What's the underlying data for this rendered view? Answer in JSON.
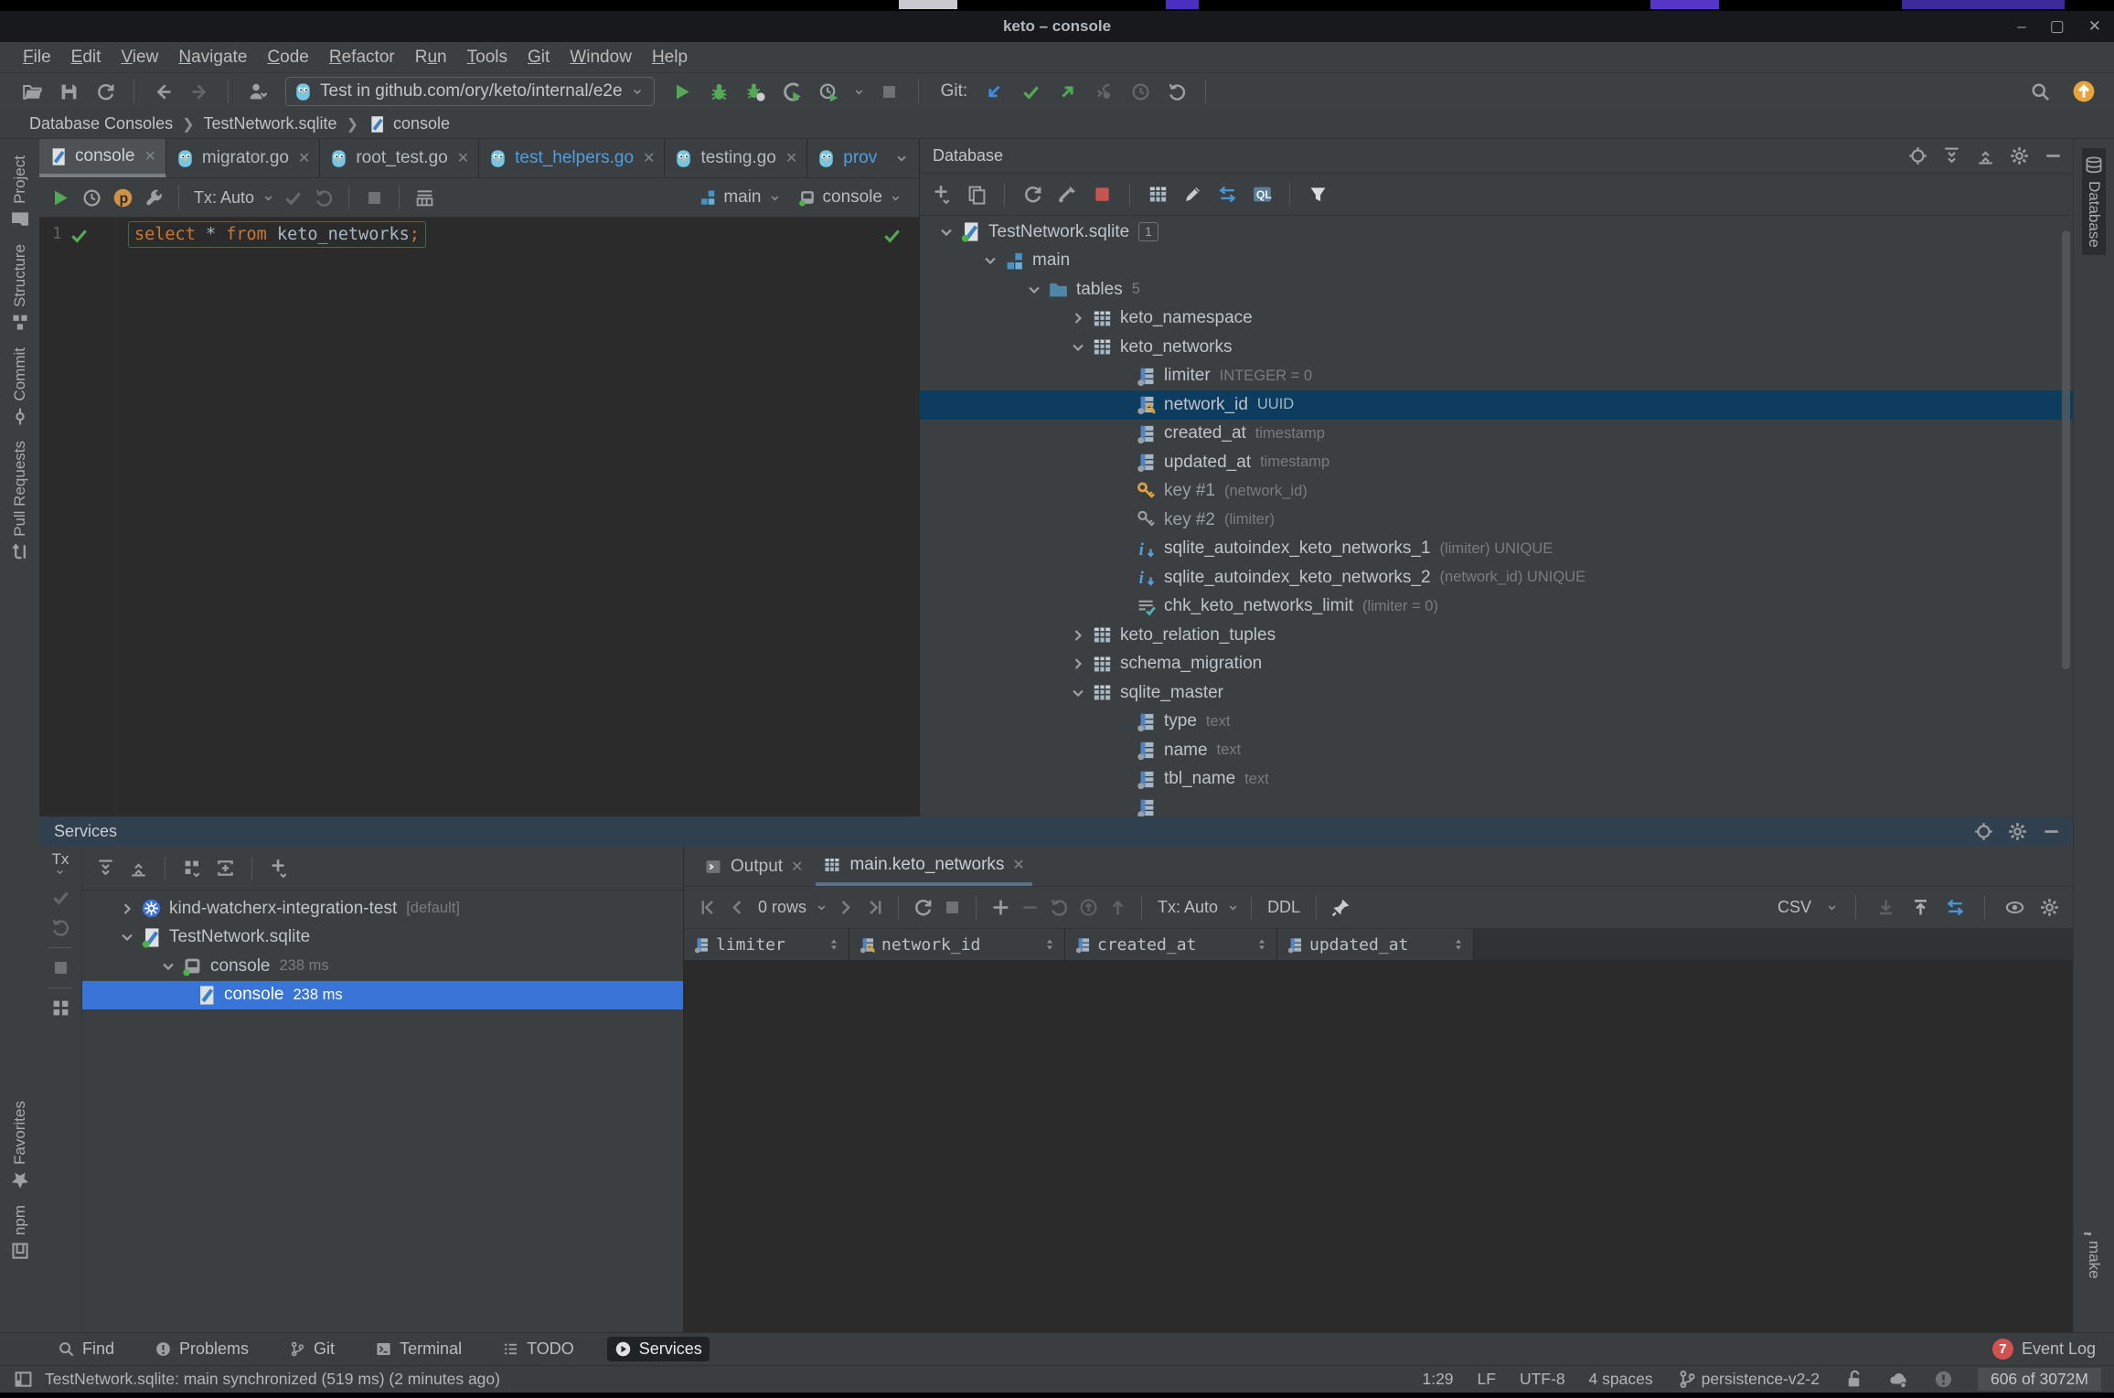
{
  "colors": {
    "panel_bg": "#3c3f41",
    "editor_bg": "#2b2b2b",
    "selection_blue": "#3875d6",
    "tree_selection": "#0d3c5e",
    "accent_green": "#54a857",
    "keyword_orange": "#cc7832",
    "key_gold": "#d9a343",
    "error_red": "#c75450",
    "event_badge_red": "#d25252",
    "services_header": "#31404f",
    "modified_tab_blue": "#4f9ee0"
  },
  "title_bar": {
    "title": "keto – console"
  },
  "menu_items": [
    {
      "label": "File",
      "u": 0
    },
    {
      "label": "Edit",
      "u": 0
    },
    {
      "label": "View",
      "u": 0
    },
    {
      "label": "Navigate",
      "u": 0
    },
    {
      "label": "Code",
      "u": 0
    },
    {
      "label": "Refactor",
      "u": 0
    },
    {
      "label": "Run",
      "u": 1
    },
    {
      "label": "Tools",
      "u": 0
    },
    {
      "label": "Git",
      "u": 0
    },
    {
      "label": "Window",
      "u": 0
    },
    {
      "label": "Help",
      "u": 0
    }
  ],
  "main_toolbar": {
    "run_config": "Test in github.com/ory/keto/internal/e2e",
    "git_label": "Git:"
  },
  "breadcrumbs": {
    "item0": "Database Consoles",
    "item1": "TestNetwork.sqlite",
    "item2": "console"
  },
  "editor_tabs": {
    "t0": "console",
    "t1": "migrator.go",
    "t2": "root_test.go",
    "t3": "test_helpers.go",
    "t4": "testing.go",
    "t5": "prov"
  },
  "console_toolbar": {
    "tx": "Tx: Auto",
    "schema": "main",
    "console": "console"
  },
  "editor": {
    "line_number": "1",
    "tok_select": "select",
    "tok_star": "*",
    "tok_from": "from",
    "tok_table": "keto_networks",
    "tok_semi": ";"
  },
  "database_panel": {
    "title": "Database",
    "tree": [
      {
        "label": "TestNetwork.sqlite",
        "badge": "1"
      },
      {
        "label": "main"
      },
      {
        "label": "tables",
        "meta": "5"
      },
      {
        "label": "keto_namespace"
      },
      {
        "label": "keto_networks"
      },
      {
        "label": "limiter",
        "meta": "INTEGER = 0"
      },
      {
        "label": "network_id",
        "meta": "UUID"
      },
      {
        "label": "created_at",
        "meta": "timestamp"
      },
      {
        "label": "updated_at",
        "meta": "timestamp"
      },
      {
        "label": "key #1",
        "meta": "(network_id)"
      },
      {
        "label": "key #2",
        "meta": "(limiter)"
      },
      {
        "label": "sqlite_autoindex_keto_networks_1",
        "meta": "(limiter) UNIQUE"
      },
      {
        "label": "sqlite_autoindex_keto_networks_2",
        "meta": "(network_id) UNIQUE"
      },
      {
        "label": "chk_keto_networks_limit",
        "meta": "(limiter = 0)"
      },
      {
        "label": "keto_relation_tuples"
      },
      {
        "label": "schema_migration"
      },
      {
        "label": "sqlite_master"
      },
      {
        "label": "type",
        "meta": "text"
      },
      {
        "label": "name",
        "meta": "text"
      },
      {
        "label": "tbl_name",
        "meta": "text"
      }
    ]
  },
  "services_panel": {
    "title": "Services",
    "tx_label": "Tx",
    "tree": [
      {
        "label": "kind-watcherx-integration-test",
        "meta": "[default]"
      },
      {
        "label": "TestNetwork.sqlite"
      },
      {
        "label": "console",
        "meta": "238 ms"
      },
      {
        "label": "console",
        "meta": "238 ms"
      }
    ],
    "output_tabs": {
      "t0": "Output",
      "t1": "main.keto_networks"
    },
    "grid_toolbar": {
      "rows": "0 rows",
      "tx": "Tx: Auto",
      "ddl": "DDL",
      "format": "CSV"
    },
    "grid_columns": {
      "c0": "limiter",
      "c1": "network_id",
      "c2": "created_at",
      "c3": "updated_at"
    }
  },
  "bottom_bar": {
    "find": "Find",
    "problems": "Problems",
    "git": "Git",
    "terminal": "Terminal",
    "todo": "TODO",
    "services": "Services",
    "event_count": "7",
    "event_log": "Event Log"
  },
  "status_bar": {
    "message": "TestNetwork.sqlite: main synchronized (519 ms) (2 minutes ago)",
    "caret": "1:29",
    "line_sep": "LF",
    "encoding": "UTF-8",
    "indent": "4 spaces",
    "branch": "persistence-v2-2",
    "memory": "606 of 3072M"
  },
  "left_stripe": {
    "project": "Project",
    "structure": "Structure",
    "commit": "Commit",
    "pull_requests": "Pull Requests",
    "favorites": "Favorites",
    "npm": "npm"
  },
  "right_stripe": {
    "database": "Database",
    "make": "make"
  }
}
